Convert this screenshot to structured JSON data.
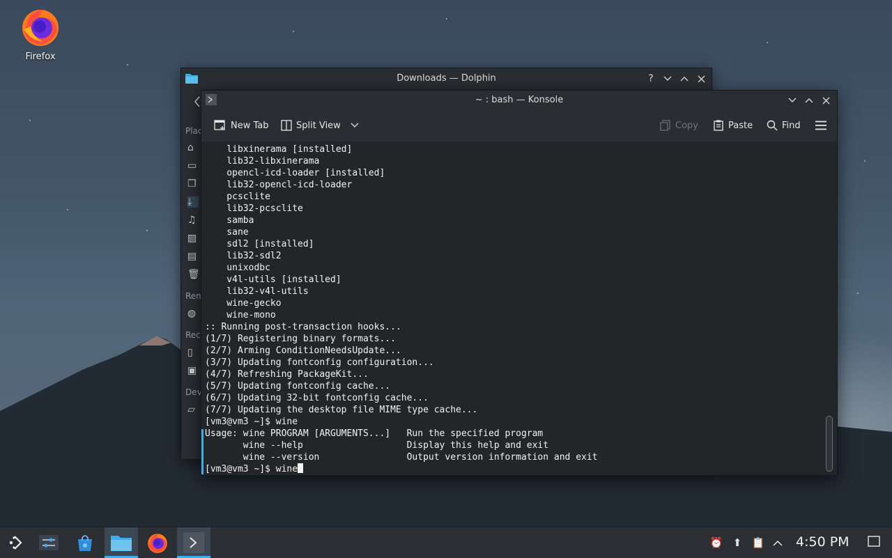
{
  "desktop": {
    "firefox_label": "Firefox"
  },
  "dolphin": {
    "title": "Downloads — Dolphin",
    "buttons": {
      "help": "?",
      "minimize": "⌄",
      "maximize": "⌃",
      "close": "✕"
    },
    "sidebar_labels": [
      "Plac",
      "Rem",
      "Rec",
      "Dev"
    ]
  },
  "konsole": {
    "title": "~ : bash — Konsole",
    "toolbar": {
      "new_tab": "New Tab",
      "split_view": "Split View",
      "copy": "Copy",
      "paste": "Paste",
      "find": "Find"
    },
    "terminal_lines": [
      "    libxinerama [installed]",
      "    lib32-libxinerama",
      "    opencl-icd-loader [installed]",
      "    lib32-opencl-icd-loader",
      "    pcsclite",
      "    lib32-pcsclite",
      "    samba",
      "    sane",
      "    sdl2 [installed]",
      "    lib32-sdl2",
      "    unixodbc",
      "    v4l-utils [installed]",
      "    lib32-v4l-utils",
      "    wine-gecko",
      "    wine-mono",
      ":: Running post-transaction hooks...",
      "(1/7) Registering binary formats...",
      "(2/7) Arming ConditionNeedsUpdate...",
      "(3/7) Updating fontconfig configuration...",
      "(4/7) Refreshing PackageKit...",
      "(5/7) Updating fontconfig cache...",
      "(6/7) Updating 32-bit fontconfig cache...",
      "(7/7) Updating the desktop file MIME type cache...",
      "[vm3@vm3 ~]$ wine",
      "Usage: wine PROGRAM [ARGUMENTS...]   Run the specified program",
      "       wine --help                   Display this help and exit",
      "       wine --version                Output version information and exit"
    ],
    "prompt_line": "[vm3@vm3 ~]$ wine"
  },
  "taskbar": {
    "clock": "4:50 PM",
    "tasks": [
      "application-launcher",
      "system-settings",
      "discover",
      "dolphin",
      "firefox",
      "konsole"
    ],
    "active_tasks": [
      "dolphin",
      "konsole"
    ]
  },
  "colors": {
    "accent": "#3daee9",
    "panel": "#2b2f33",
    "terminal_bg": "#232629"
  }
}
